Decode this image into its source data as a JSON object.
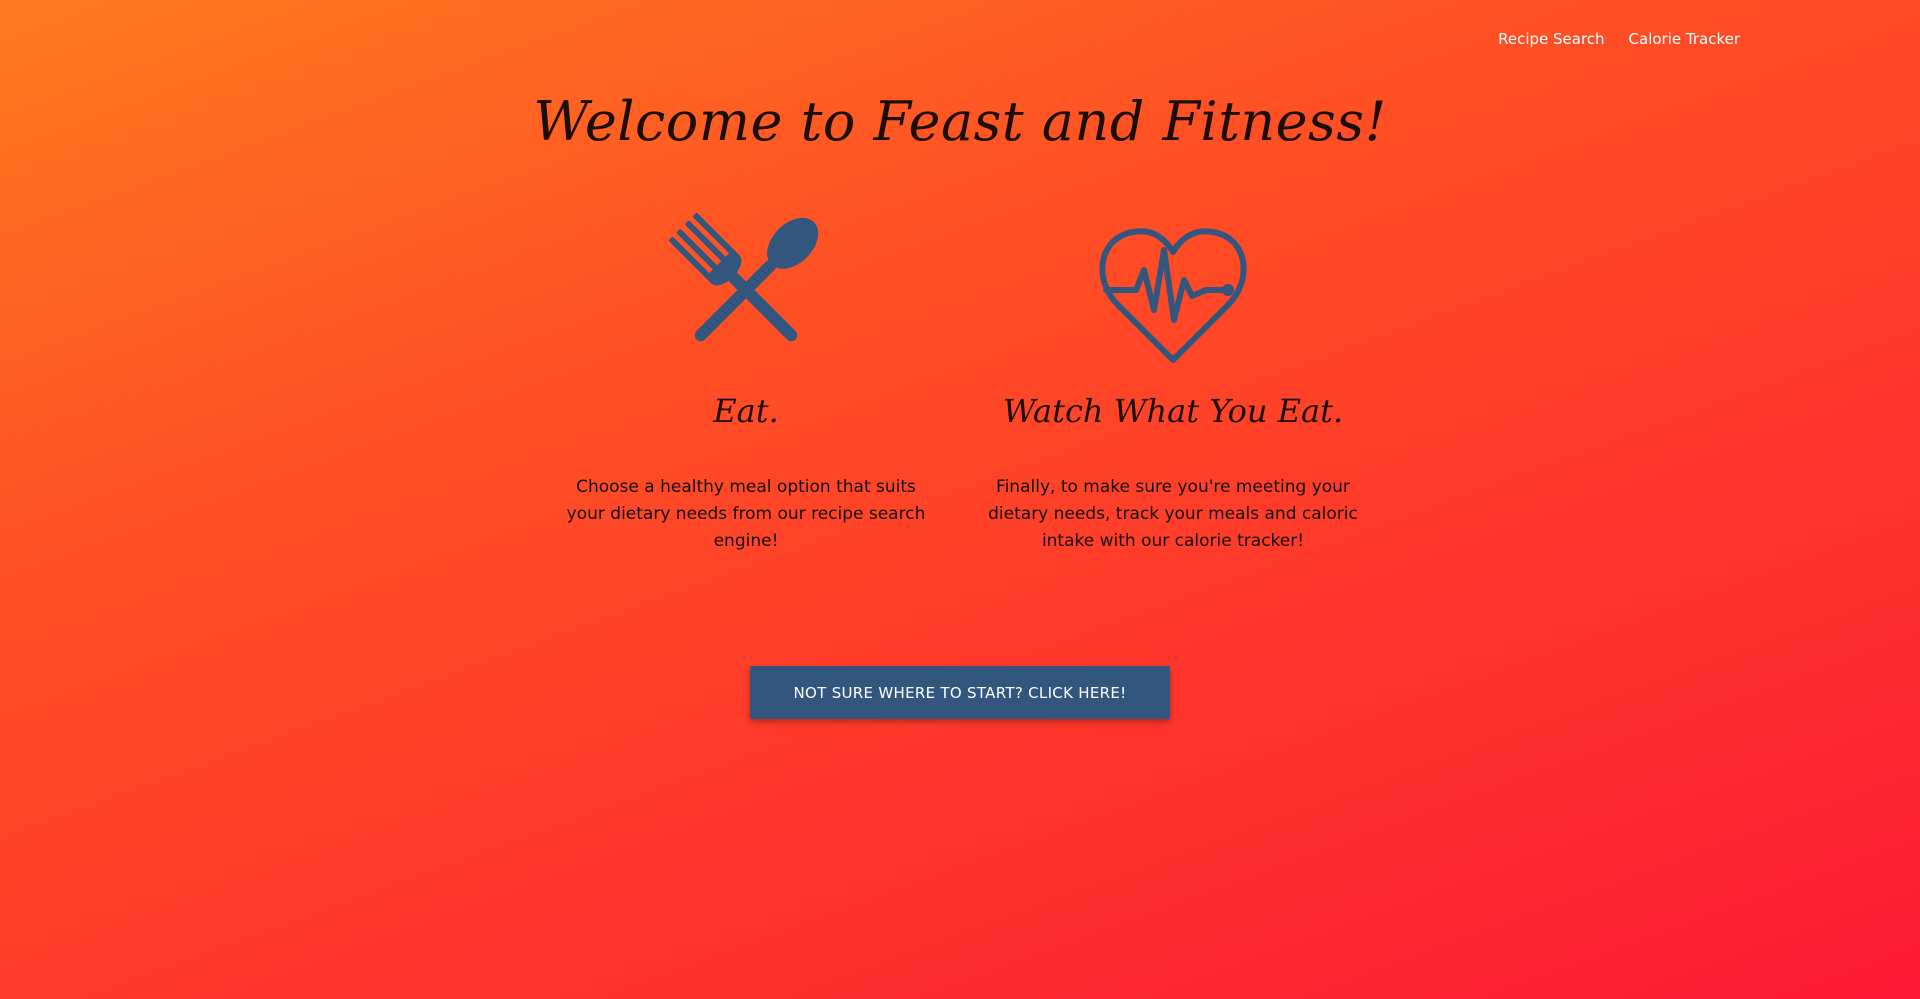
{
  "nav": {
    "items": [
      {
        "label": "Recipe Search"
      },
      {
        "label": "Calorie Tracker"
      }
    ]
  },
  "hero": {
    "title": "Welcome to Feast and Fitness!"
  },
  "features": [
    {
      "icon": "fork-spoon-icon",
      "heading": "Eat.",
      "text": "Choose a healthy meal option that suits your dietary needs from our recipe search engine!"
    },
    {
      "icon": "heartbeat-icon",
      "heading": "Watch What You Eat.",
      "text": "Finally, to make sure you're meeting your dietary needs, track your meals and caloric intake with our calorie tracker!"
    }
  ],
  "cta": {
    "label": "NOT SURE WHERE TO START? CLICK HERE!"
  },
  "colors": {
    "gradient_start": "#ff7a1f",
    "gradient_end": "#fb1a34",
    "icon": "#33567f",
    "button": "#33567f",
    "nav_text": "#ffffff"
  }
}
